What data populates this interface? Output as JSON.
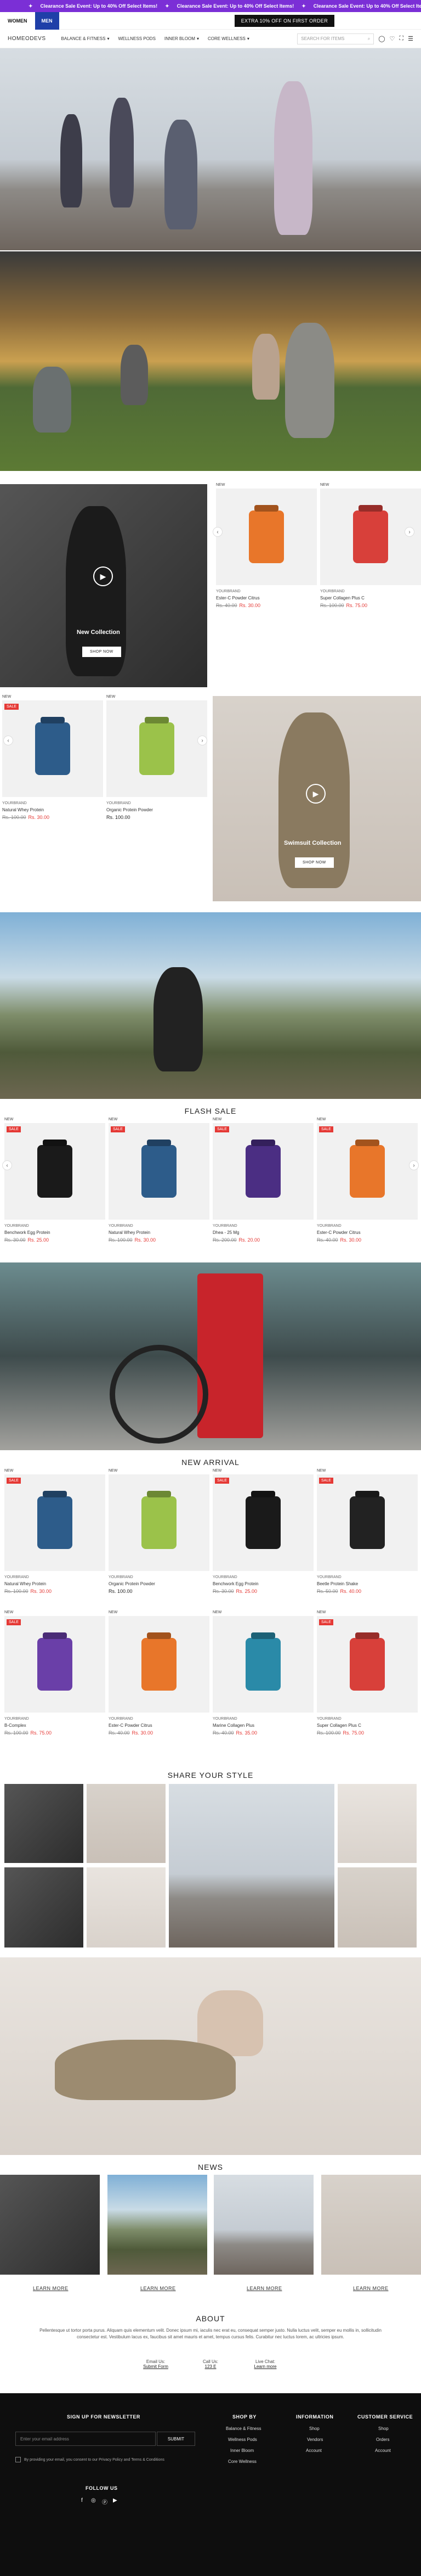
{
  "announcement": {
    "items": [
      "Clearance Sale Event: Up to 40% Off Select Items!",
      "Clearance Sale Event: Up to 40% Off Select Items!",
      "Clearance Sale Event: Up to 40% Off Select Items!",
      "Clearance Sale Event"
    ]
  },
  "topbar": {
    "women": "WOMEN",
    "men": "MEN",
    "promo": "EXTRA 10% OFF ON FIRST ORDER"
  },
  "header": {
    "logo": "HOMEODEVS",
    "nav": [
      "BALANCE & FITNESS",
      "WELLNESS PODS",
      "INNER BLOOM",
      "CORE WELLNESS"
    ],
    "search_placeholder": "SEARCH FOR ITEMS"
  },
  "promo_video": {
    "title": "New Collection",
    "button": "SHOP NOW"
  },
  "promo_video2": {
    "title": "Swimsuit Collection",
    "button": "SHOP NOW"
  },
  "row1": [
    {
      "badge": "NEW",
      "brand": "YOURBRAND",
      "name": "Ester-C Powder Citrus",
      "old": "Rs. 40.00",
      "new": "Rs. 30.00",
      "color": "#e8762a"
    },
    {
      "badge": "NEW",
      "brand": "YOURBRAND",
      "name": "Super Collagen Plus C",
      "old": "Rs. 100.00",
      "new": "Rs. 75.00",
      "color": "#d8403a"
    }
  ],
  "row2": [
    {
      "badge": "NEW",
      "sale": "SALE",
      "brand": "YOURBRAND",
      "name": "Natural Whey Protein",
      "old": "Rs. 100.00",
      "new": "Rs. 30.00",
      "color": "#2d5c8a"
    },
    {
      "badge": "NEW",
      "brand": "YOURBRAND",
      "name": "Organic Protein Powder",
      "reg": "Rs. 100.00",
      "color": "#9bc24a"
    }
  ],
  "flash_sale": {
    "title": "FLASH SALE",
    "items": [
      {
        "badge": "NEW",
        "sale": "SALE",
        "brand": "YOURBRAND",
        "name": "Benchwork Egg Protein",
        "old": "Rs. 30.00",
        "new": "Rs. 25.00",
        "color": "#1a1a1a"
      },
      {
        "badge": "NEW",
        "sale": "SALE",
        "brand": "YOURBRAND",
        "name": "Natural Whey Protein",
        "old": "Rs. 100.00",
        "new": "Rs. 30.00",
        "color": "#2d5c8a"
      },
      {
        "badge": "NEW",
        "sale": "SALE",
        "brand": "YOURBRAND",
        "name": "Dhea - 25 Mg",
        "old": "Rs. 200.00",
        "new": "Rs. 20.00",
        "color": "#4b2e83"
      },
      {
        "badge": "NEW",
        "sale": "SALE",
        "brand": "YOURBRAND",
        "name": "Ester-C Powder Citrus",
        "old": "Rs. 40.00",
        "new": "Rs. 30.00",
        "color": "#e8762a"
      }
    ]
  },
  "new_arrival": {
    "title": "NEW ARRIVAL",
    "items": [
      {
        "badge": "NEW",
        "sale": "SALE",
        "brand": "YOURBRAND",
        "name": "Natural Whey Protein",
        "old": "Rs. 100.00",
        "new": "Rs. 30.00",
        "color": "#2d5c8a"
      },
      {
        "badge": "NEW",
        "brand": "YOURBRAND",
        "name": "Organic Protein Powder",
        "reg": "Rs. 100.00",
        "color": "#9bc24a"
      },
      {
        "badge": "NEW",
        "sale": "SALE",
        "brand": "YOURBRAND",
        "name": "Benchwork Egg Protein",
        "old": "Rs. 30.00",
        "new": "Rs. 25.00",
        "color": "#1a1a1a"
      },
      {
        "badge": "NEW",
        "sale": "SALE",
        "brand": "YOURBRAND",
        "name": "Beetle Protein Shake",
        "old": "Rs. 50.00",
        "new": "Rs. 40.00",
        "color": "#222"
      },
      {
        "badge": "NEW",
        "sale": "SALE",
        "brand": "YOURBRAND",
        "name": "B-Complex",
        "old": "Rs. 100.00",
        "new": "Rs. 75.00",
        "color": "#6a3fa8"
      },
      {
        "badge": "NEW",
        "brand": "YOURBRAND",
        "name": "Ester-C Powder Citrus",
        "old": "Rs. 40.00",
        "new": "Rs. 30.00",
        "color": "#e8762a"
      },
      {
        "badge": "NEW",
        "brand": "YOURBRAND",
        "name": "Marine Collagen Plus",
        "old": "Rs. 40.00",
        "new": "Rs. 35.00",
        "color": "#2a8aa8"
      },
      {
        "badge": "NEW",
        "sale": "SALE",
        "brand": "YOURBRAND",
        "name": "Super Collagen Plus C",
        "old": "Rs. 100.00",
        "new": "Rs. 75.00",
        "color": "#d8403a"
      }
    ]
  },
  "share_style": {
    "title": "SHARE YOUR STYLE"
  },
  "news": {
    "title": "NEWS",
    "links": [
      "LEARN MORE",
      "LEARN MORE",
      "LEARN MORE",
      "LEARN MORE"
    ]
  },
  "about": {
    "title": "ABOUT",
    "text": "Pellentesque ut tortor porta purus. Aliquam quis elementum velit. Donec ipsum mi, iaculis nec erat eu, consequat semper justo. Nulla luctus velit, semper eu mollis in, sollicitudin consectetur est. Vestibulum lacus ex, faucibus sit amet mauris et amet, tempus cursus felis. Curabitur nec luctus lorem, ac ultricies ipsum.",
    "contacts": [
      {
        "label": "Email Us:",
        "value": "Submit Form"
      },
      {
        "label": "Call Us:",
        "value": "123 E"
      },
      {
        "label": "Live Chat:",
        "value": "Learn more"
      }
    ]
  },
  "footer": {
    "newsletter": "SIGN UP FOR NEWSLETTER",
    "email_placeholder": "Enter your email address",
    "submit": "SUBMIT",
    "consent": "By providing your email, you consent to our Privacy Policy and Terms & Conditions",
    "follow": "FOLLOW US",
    "shop_by": {
      "title": "SHOP BY",
      "items": [
        "Balance & Fitness",
        "Wellness Pods",
        "Inner Bloom",
        "Core Wellness"
      ]
    },
    "information": {
      "title": "INFORMATION",
      "items": [
        "Shop",
        "Vendors",
        "Account"
      ]
    },
    "customer_service": {
      "title": "CUSTOMER SERVICE",
      "items": [
        "Shop",
        "Orders",
        "Account"
      ]
    }
  }
}
